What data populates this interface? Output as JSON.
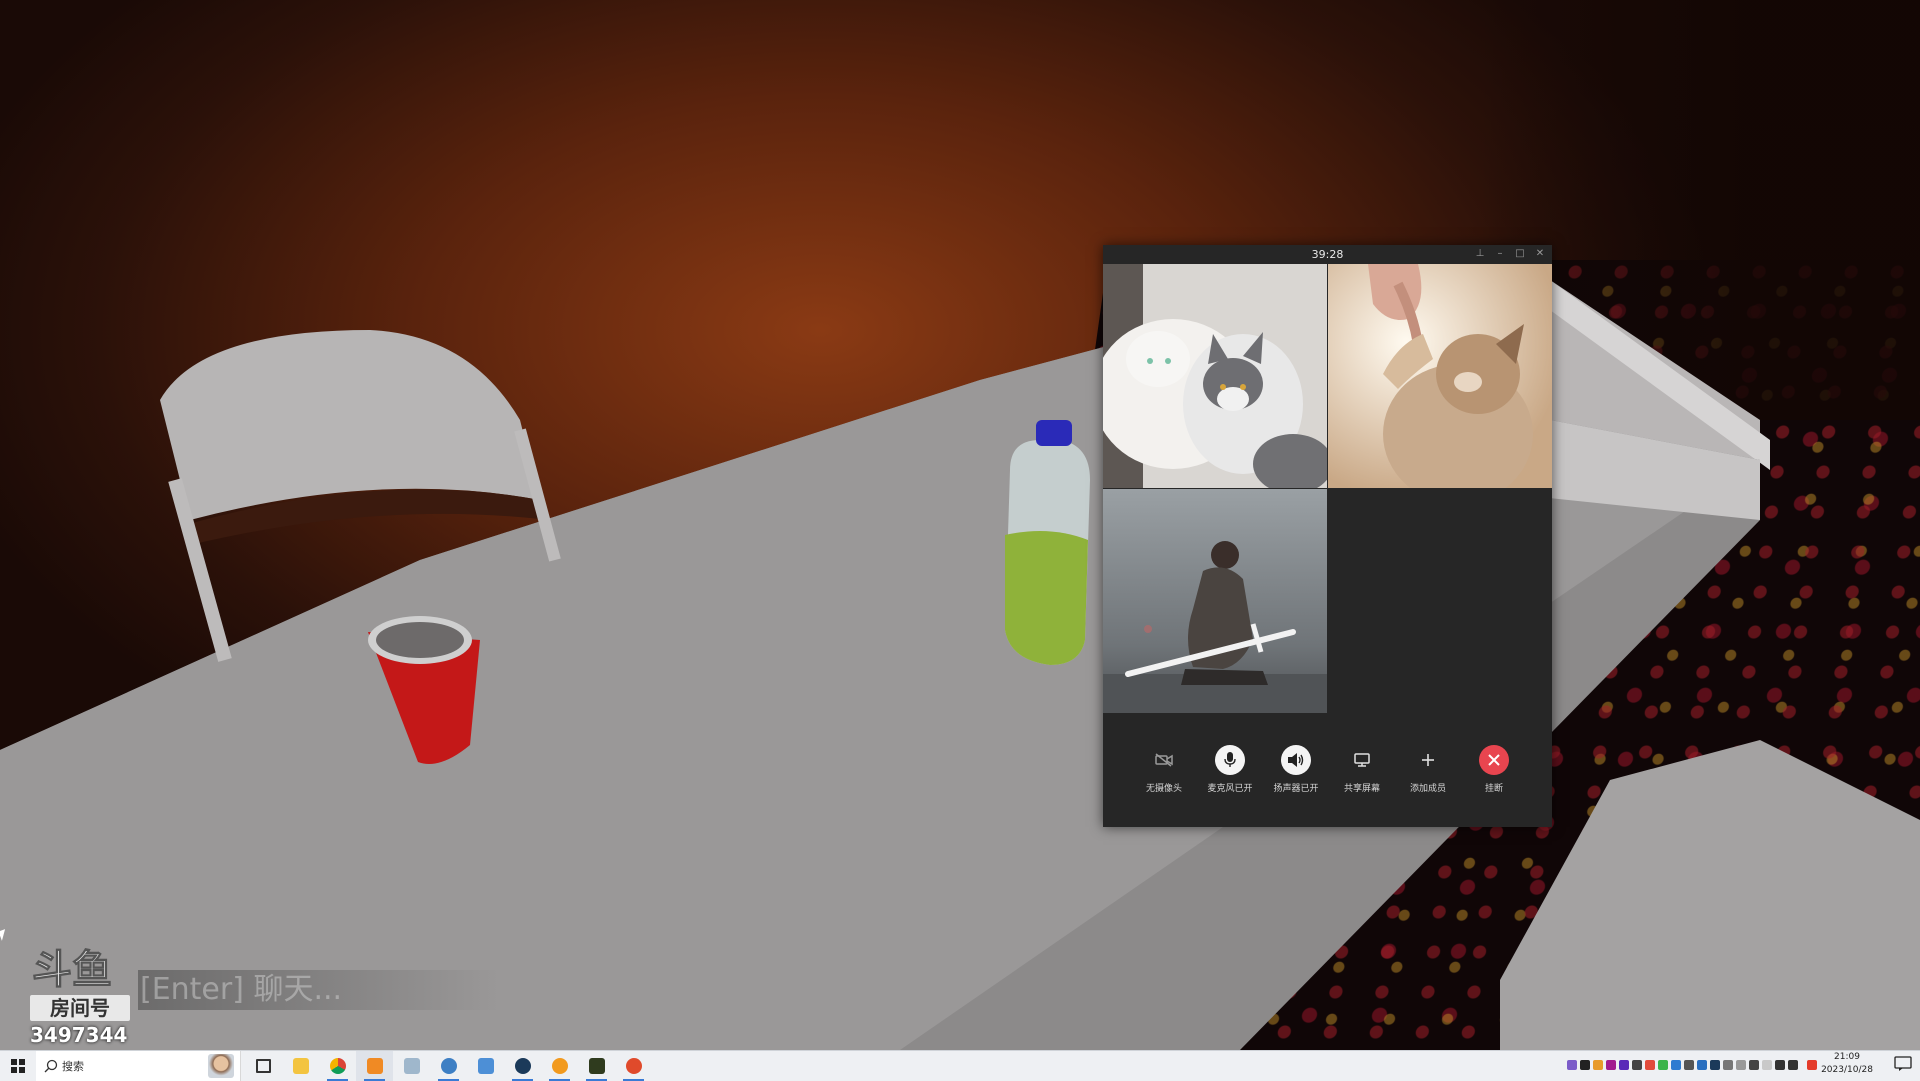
{
  "call_window": {
    "timer": "39:28",
    "window_controls": [
      "pin",
      "minimize",
      "maximize",
      "close"
    ],
    "participants": [
      {
        "id": 1,
        "video": "two-cats"
      },
      {
        "id": 2,
        "video": "kitten-hand"
      },
      {
        "id": 3,
        "video": "kneeling-swordsman"
      }
    ],
    "controls": [
      {
        "name": "camera",
        "label": "无摄像头",
        "icon": "camera-off-icon"
      },
      {
        "name": "microphone",
        "label": "麦克风已开",
        "icon": "microphone-icon"
      },
      {
        "name": "speaker",
        "label": "扬声器已开",
        "icon": "speaker-icon"
      },
      {
        "name": "share-screen",
        "label": "共享屏幕",
        "icon": "monitor-icon"
      },
      {
        "name": "add-member",
        "label": "添加成员",
        "icon": "plus-icon"
      },
      {
        "name": "hang-up",
        "label": "挂断",
        "icon": "close-icon"
      }
    ],
    "colors": {
      "background": "#262626",
      "hangup": "#e8454f"
    }
  },
  "overlay": {
    "logo_text": "斗鱼",
    "room_label": "房间号",
    "room_number": "3497344",
    "chat_hint": "[Enter] 聊天..."
  },
  "taskbar": {
    "search_placeholder": "搜索",
    "apps": [
      "task-view",
      "file-explorer",
      "chrome",
      "wechat",
      "mail",
      "app-bird",
      "app-save",
      "steam",
      "app-flame",
      "app-terminal",
      "app-arrow"
    ],
    "clock": {
      "time": "21:09",
      "date": "2023/10/28"
    }
  }
}
